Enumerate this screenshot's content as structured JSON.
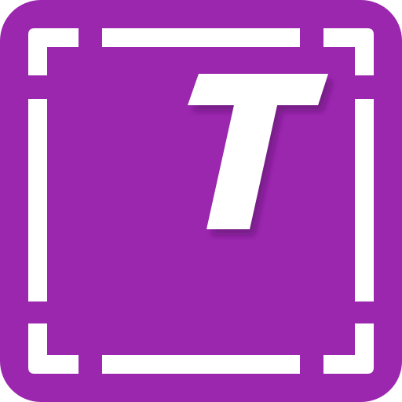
{
  "icon": {
    "glyph": "T",
    "background_color": "#9B27AF",
    "frame_color": "#FFFFFF",
    "glyph_color": "#FFFFFF",
    "shadow_color": "#5A1268"
  }
}
